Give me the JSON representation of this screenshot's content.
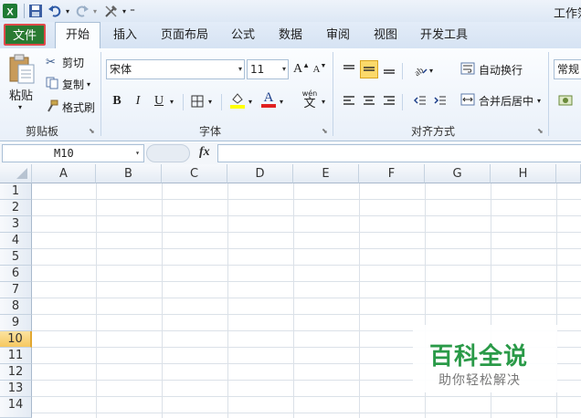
{
  "window": {
    "title": "工作簿"
  },
  "quick_access": {
    "customize_symbol": "⁼"
  },
  "tabs": {
    "file": "文件",
    "home": "开始",
    "insert": "插入",
    "page_layout": "页面布局",
    "formulas": "公式",
    "data": "数据",
    "review": "审阅",
    "view": "视图",
    "developer": "开发工具"
  },
  "clipboard": {
    "paste": "粘贴",
    "cut": "剪切",
    "copy": "复制",
    "format_painter": "格式刷",
    "group_label": "剪贴板"
  },
  "font": {
    "font_name": "宋体",
    "font_size": "11",
    "bold": "B",
    "italic": "I",
    "underline": "U",
    "font_color_letter": "A",
    "phonetic": "wén",
    "phonetic_char": "文",
    "group_label": "字体"
  },
  "alignment": {
    "wrap_text": "自动换行",
    "merge_center": "合并后居中",
    "group_label": "对齐方式"
  },
  "number": {
    "format": "常规"
  },
  "formula_bar": {
    "name_box": "M10",
    "fx": "fx",
    "value": ""
  },
  "sheet": {
    "columns": [
      "A",
      "B",
      "C",
      "D",
      "E",
      "F",
      "G",
      "H"
    ],
    "rows": [
      "1",
      "2",
      "3",
      "4",
      "5",
      "6",
      "7",
      "8",
      "9",
      "10",
      "11",
      "12",
      "13",
      "14"
    ],
    "active_row": "10"
  },
  "watermark": {
    "title": "百科全说",
    "subtitle": "助你轻松解决"
  },
  "colors": {
    "file_tab": "#2a7a32",
    "highlight_border": "#e04a4a",
    "active_row_header": "#f6c860",
    "fill_yellow": "#ffff00",
    "font_red": "#e02020"
  }
}
